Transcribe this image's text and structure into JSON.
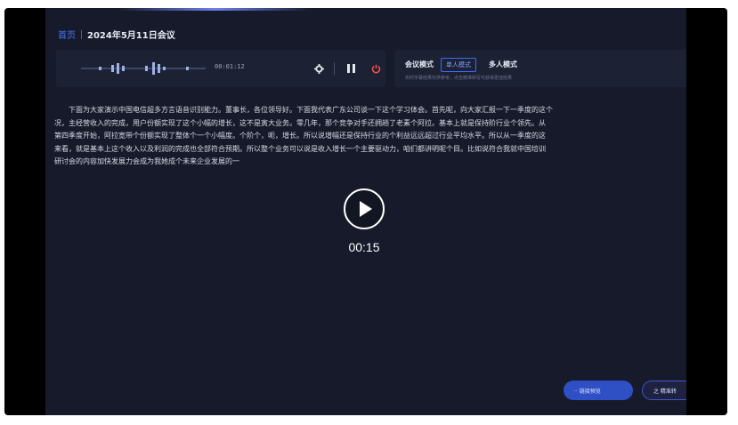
{
  "breadcrumb": {
    "home": "首页",
    "current": "2024年5月11日会议"
  },
  "audio": {
    "time": "00:01:12"
  },
  "mode": {
    "label": "会议模式",
    "single": "单人模式",
    "multi": "多人模式",
    "hint": "实时字幕结果仅供参考，点击精准转写可获得更佳结果"
  },
  "transcript": [
    "下面为大家演示中国电信超多方言语音识别能力。董事长，各位领导好。下面我代表广东公司谈一下这个学习体会。首先呢，向大家汇报一下一季度的这个",
    "况，主经营收入的完成，用户份额实现了这个小幅的增长，这不是寅大业务。零几年，那个竞争对手还拥趟了老素个阿拉。基本上就是保持阶行业个领先。从",
    "第四季度开始，阿拉宽带个份额实现了整体个一个小幅度。个阶个，呃，增长。所以说增幅还是保持行业的个利益远远超过行业平均水平。所以从一季度的这",
    "来看，就是基本上这个收入以及利润的完成也全部符合预期。所以整个业务可以说是收入增长一个主要驱动力，咱们都讲明呢个目。比如说符合我就中国培训",
    "研讨会的内容加快发展力会成为我她成个未来企业发展的一"
  ],
  "video": {
    "duration": "00:15"
  },
  "actions": {
    "preview": "·· 链接预览",
    "precise": "之 精准转"
  },
  "colors": {
    "accent": "#3d6bff",
    "power": "#ff4d4f"
  }
}
